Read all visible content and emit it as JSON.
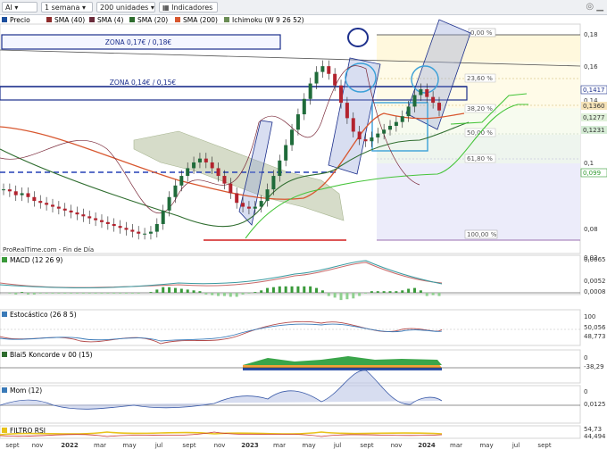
{
  "toolbar": {
    "symbol": "AI",
    "period": "1 semana",
    "units": "200 unidades",
    "indicators_btn": "Indicadores"
  },
  "legend": {
    "price": "Precio",
    "sma40": "SMA (40)",
    "sma4": "SMA (4)",
    "sma20": "SMA (20)",
    "sma200": "SMA (200)",
    "ichimoku": "Ichimoku (W 9 26 52)"
  },
  "colors": {
    "up": "#1f6b3a",
    "down": "#b3232e",
    "sma40": "#8e2b2b",
    "sma4": "#6a2b3b",
    "sma20": "#2f6d2f",
    "sma200": "#d8572f",
    "kumo": "#cfd8c6",
    "zone": "#1c2f8c",
    "macd_up": "#3a9a3a",
    "rsi": "#e8c21a"
  },
  "annotations": {
    "zona1": "ZONA 0,17€ / 0,18€",
    "zona2": "ZONA 0,14€ / 0,15€",
    "source": "ProRealTime.com - Fin de Día"
  },
  "fibo": [
    "0,00 %",
    "23,60 %",
    "38,20 %",
    "50,00 %",
    "61,80 %",
    "100,00 %"
  ],
  "price_axis": [
    "0,18",
    "0,16",
    "0,14",
    "0,1",
    "0,08",
    "0,02"
  ],
  "price_badges": [
    "0,1417",
    "0,1360",
    "0,1277",
    "0,1231",
    "0,099"
  ],
  "panels": {
    "macd": {
      "label": "MACD (12 26 9)",
      "values": [
        "0,0065",
        "0,0052",
        "0,0008"
      ]
    },
    "stoch": {
      "label": "Estocástico (26 8 5)",
      "values": [
        "100",
        "50,056",
        "48,773"
      ]
    },
    "blai5": {
      "label": "Blai5 Koncorde v 00 (15)",
      "values": [
        "0",
        "-38,29"
      ]
    },
    "mom": {
      "label": "Mom (12)",
      "values": [
        "0",
        "0,0125"
      ]
    },
    "rsi": {
      "label": "FILTRO RSI",
      "values": [
        "54,73",
        "44,494"
      ]
    }
  },
  "time_axis": [
    "sept",
    "nov",
    "2022",
    "mar",
    "may",
    "jul",
    "sept",
    "nov",
    "2023",
    "mar",
    "may",
    "jul",
    "sept",
    "nov",
    "2024",
    "mar",
    "may",
    "jul",
    "sept"
  ],
  "chart_data": {
    "type": "candlestick",
    "title": "",
    "xlabel": "",
    "ylabel": "",
    "ylim": [
      0.07,
      0.185
    ],
    "grid": false,
    "series": [
      {
        "name": "Precio",
        "close": [
          0.101,
          0.1,
          0.098,
          0.099,
          0.097,
          0.095,
          0.094,
          0.093,
          0.092,
          0.091,
          0.09,
          0.089,
          0.088,
          0.087,
          0.086,
          0.085,
          0.084,
          0.083,
          0.082,
          0.081,
          0.08,
          0.079,
          0.078,
          0.078,
          0.079,
          0.083,
          0.09,
          0.097,
          0.103,
          0.108,
          0.112,
          0.115,
          0.117,
          0.115,
          0.112,
          0.108,
          0.104,
          0.099,
          0.094,
          0.092,
          0.091,
          0.092,
          0.095,
          0.101,
          0.108,
          0.116,
          0.124,
          0.132,
          0.14,
          0.148,
          0.156,
          0.162,
          0.165,
          0.161,
          0.155,
          0.146,
          0.138,
          0.131,
          0.127,
          0.126,
          0.128,
          0.13,
          0.132,
          0.134,
          0.136,
          0.139,
          0.144,
          0.15,
          0.153,
          0.149,
          0.146,
          0.142
        ]
      }
    ],
    "zones": [
      {
        "label": "ZONA 0,17€ / 0,18€",
        "from": 0.17,
        "to": 0.18
      },
      {
        "label": "ZONA 0,14€ / 0,15€",
        "from": 0.14,
        "to": 0.15
      }
    ]
  }
}
